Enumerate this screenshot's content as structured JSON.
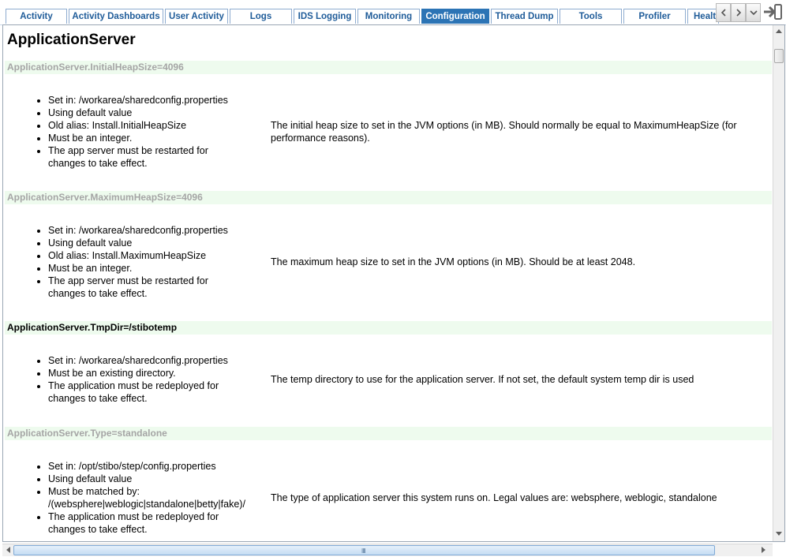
{
  "tabs": [
    {
      "label": "Activity"
    },
    {
      "label": "Activity Dashboards"
    },
    {
      "label": "User Activity"
    },
    {
      "label": "Logs"
    },
    {
      "label": "IDS Logging"
    },
    {
      "label": "Monitoring"
    },
    {
      "label": "Configuration"
    },
    {
      "label": "Thread Dump"
    },
    {
      "label": "Tools"
    },
    {
      "label": "Profiler"
    },
    {
      "label": "Health"
    }
  ],
  "active_tab": "Configuration",
  "icons": {
    "prev": "chevron-left-icon",
    "next": "chevron-right-icon",
    "menu": "chevron-down-icon",
    "exit": "logout-icon"
  },
  "colors": {
    "accent": "#2c74b5",
    "tab_text": "#1f5c99",
    "header_bg": "#eefbee",
    "default_key": "#a5a5a5"
  },
  "page": {
    "title": "ApplicationServer"
  },
  "properties": [
    {
      "key": "ApplicationServer.InitialHeapSize=4096",
      "is_default": true,
      "details": [
        "Set in: /workarea/sharedconfig.properties",
        "Using default value",
        "Old alias: Install.InitialHeapSize",
        "Must be an integer.",
        "The app server must be restarted for changes to take effect."
      ],
      "description": "The initial heap size to set in the JVM options (in MB). Should normally be equal to MaximumHeapSize (for performance reasons)."
    },
    {
      "key": "ApplicationServer.MaximumHeapSize=4096",
      "is_default": true,
      "details": [
        "Set in: /workarea/sharedconfig.properties",
        "Using default value",
        "Old alias: Install.MaximumHeapSize",
        "Must be an integer.",
        "The app server must be restarted for changes to take effect."
      ],
      "description": "The maximum heap size to set in the JVM options (in MB). Should be at least 2048."
    },
    {
      "key": "ApplicationServer.TmpDir=/stibotemp",
      "is_default": false,
      "details": [
        "Set in: /workarea/sharedconfig.properties",
        "Must be an existing directory.",
        "The application must be redeployed for changes to take effect."
      ],
      "description": "The temp directory to use for the application server. If not set, the default system temp dir is used"
    },
    {
      "key": "ApplicationServer.Type=standalone",
      "is_default": true,
      "details": [
        "Set in: /opt/stibo/step/config.properties",
        "Using default value",
        "Must be matched by: /(websphere|weblogic|standalone|betty|fake)/",
        "The application must be redeployed for changes to take effect."
      ],
      "description": "The type of application server this system runs on. Legal values are: websphere, weblogic, standalone"
    }
  ]
}
